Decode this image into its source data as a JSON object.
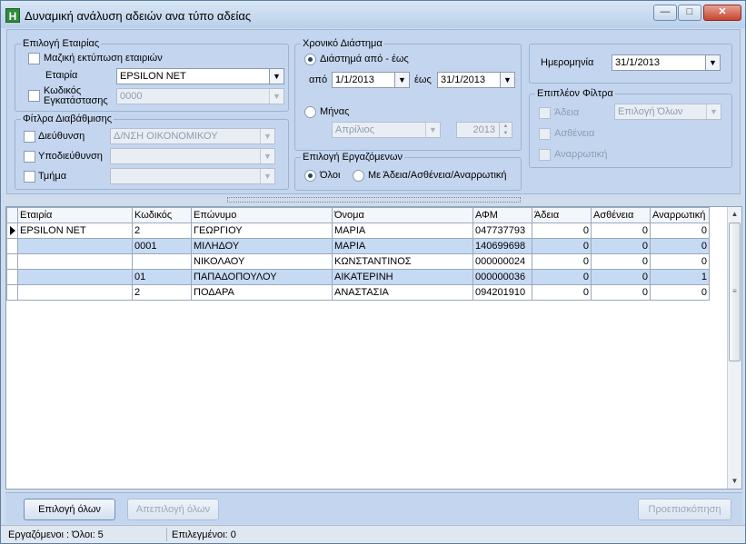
{
  "window": {
    "title": "Δυναμική ανάλυση αδειών ανα τύπο αδείας",
    "app_icon_letter": "H",
    "buttons": {
      "minimize": "—",
      "maximize": "□",
      "close": "✕"
    }
  },
  "company": {
    "legend": "Επιλογή Εταιρίας",
    "mass_print_label": "Μαζική εκτύπωση εταιριών",
    "company_label": "Εταιρία",
    "company_value": "EPSILON NET",
    "install_code_label_1": "Κωδικός",
    "install_code_label_2": "Εγκατάστασης",
    "install_code_value": "0000"
  },
  "grading": {
    "legend": "Φίτλρα Διαβάθμισης",
    "direction_label": "Διεύθυνση",
    "direction_value": "Δ/ΝΣΗ ΟΙΚΟΝΟΜΙΚΟΥ",
    "subdirection_label": "Υποδιεύθυνση",
    "subdirection_value": "",
    "department_label": "Τμήμα",
    "department_value": ""
  },
  "period": {
    "legend": "Χρονικό Διάστημα",
    "range_label": "Διάστημά από - έως",
    "from_label": "από",
    "from_value": "1/1/2013",
    "to_label": "έως",
    "to_value": "31/1/2013",
    "month_label": "Μήνας",
    "month_value": "Απρίλιος",
    "year_value": "2013"
  },
  "employees": {
    "legend": "Επιλογή Εργαζόμενων",
    "all_label": "Όλοι",
    "with_label": "Με Άδεια/Ασθένεια/Αναρρωτική"
  },
  "date": {
    "label": "Ημερομηνία",
    "value": "31/1/2013"
  },
  "extra_filters": {
    "legend": "Επιπλέον Φίλτρα",
    "leave_label": "Άδεια",
    "leave_select": "Επιλογή Όλων",
    "sickness_label": "Ασθένεια",
    "sick_leave_label": "Αναρρωτική"
  },
  "table": {
    "columns": [
      "Εταιρία",
      "Κωδικός",
      "Επώνυμο",
      "Όνομα",
      "ΑΦΜ",
      "Άδεια",
      "Ασθένεια",
      "Αναρρωτική"
    ],
    "rows": [
      [
        "EPSILON NET",
        "2",
        "ΓΕΩΡΓΙΟΥ",
        "ΜΑΡΙΑ",
        "047737793",
        "0",
        "0",
        "0"
      ],
      [
        "",
        "0001",
        "ΜΙΛΗΔΟΥ",
        "ΜΑΡΙΑ",
        "140699698",
        "0",
        "0",
        "0"
      ],
      [
        "",
        "",
        "ΝΙΚΟΛΑΟΥ",
        "ΚΩΝΣΤΑΝΤΙΝΟΣ",
        "000000024",
        "0",
        "0",
        "0"
      ],
      [
        "",
        "01",
        "ΠΑΠΑΔΟΠΟΥΛΟΥ",
        "ΑΙΚΑΤΕΡΙΝΗ",
        "000000036",
        "0",
        "0",
        "1"
      ],
      [
        "",
        "2",
        "ΠΟΔΑΡΑ",
        "ΑΝΑΣΤΑΣΙΑ",
        "094201910",
        "0",
        "0",
        "0"
      ]
    ]
  },
  "buttons": {
    "select_all": "Επιλογή όλων",
    "deselect_all": "Απεπιλογή όλων",
    "preview": "Προεπισκόπηση"
  },
  "status": {
    "employees": "Εργαζόμενοι :  Όλοι: 5",
    "selected": "Επιλεγμένοι: 0"
  }
}
